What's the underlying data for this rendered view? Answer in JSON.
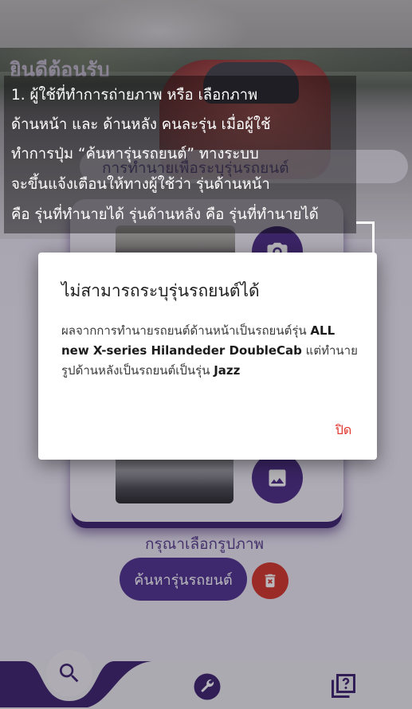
{
  "welcome": "ยินดีต้อนรับ",
  "search_bar_text": "การทำนายเพื่อระบุรุ่นรถยนต์",
  "instructions": [
    "1. ผู้ใช้ที่ทำการถ่ายภาพ หรือ เลือกภาพ",
    "ด้านหน้า และ ด้านหลัง คนละรุ่น เมื่อผู้ใช้",
    "ทำการปุ่ม “ค้นหารุ่นรถยนต์”  ทางระบบ",
    "จะขึ้นแจ้งเตือนให้ทางผู้ใช้ว่า รุ่นด้านหน้า",
    "คือ รุ่นที่ทำนายได้  รุ่นด้านหลัง คือ รุ่นที่ทำนายได้"
  ],
  "dialog": {
    "title": "ไม่สามารถระบุรุ่นรถยนต์ได้",
    "body_prefix": "ผลจากการทำนายรถยนต์ด้านหน้าเป็นรถยนต์รุ่น ",
    "front_model": "ALL new X-series Hilandeder DoubleCab",
    "body_middle": " แต่ทำนายรูปด้านหลังเป็นรถยนต์เป็นรุ่น ",
    "back_model": "Jazz",
    "close_label": "ปิด"
  },
  "prompt": "กรุณาเลือกรูปภาพ",
  "search_button": "ค้นหารุ่นรถยนต์",
  "colors": {
    "primary": "#513491",
    "danger": "#d6372c",
    "close_text": "#e0342a"
  },
  "icons": {
    "camera": "camera-icon",
    "image": "image-icon",
    "delete": "delete-icon",
    "search": "search-icon",
    "tools": "wrench-icon",
    "help": "help-icon"
  }
}
